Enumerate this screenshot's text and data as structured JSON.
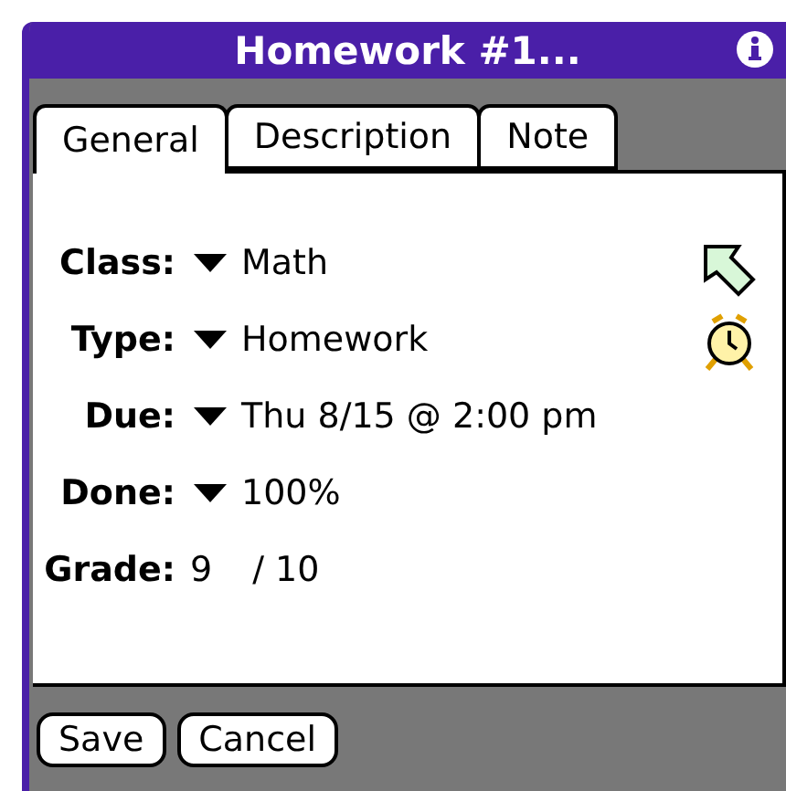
{
  "window": {
    "title": "Homework #1..."
  },
  "tabs": [
    {
      "label": "General",
      "selected": true
    },
    {
      "label": "Description",
      "selected": false
    },
    {
      "label": "Note",
      "selected": false
    }
  ],
  "fields": [
    {
      "kind": "popup",
      "label": "Class:",
      "value": "Math"
    },
    {
      "kind": "popup",
      "label": "Type:",
      "value": "Homework"
    },
    {
      "kind": "popup",
      "label": "Due:",
      "value": "Thu 8/15 @ 2:00 pm"
    },
    {
      "kind": "popup",
      "label": "Done:",
      "value": "100%"
    },
    {
      "kind": "grade",
      "label": "Grade:",
      "value": "9",
      "total": "/ 10"
    }
  ],
  "buttons": [
    "Save",
    "Cancel"
  ]
}
